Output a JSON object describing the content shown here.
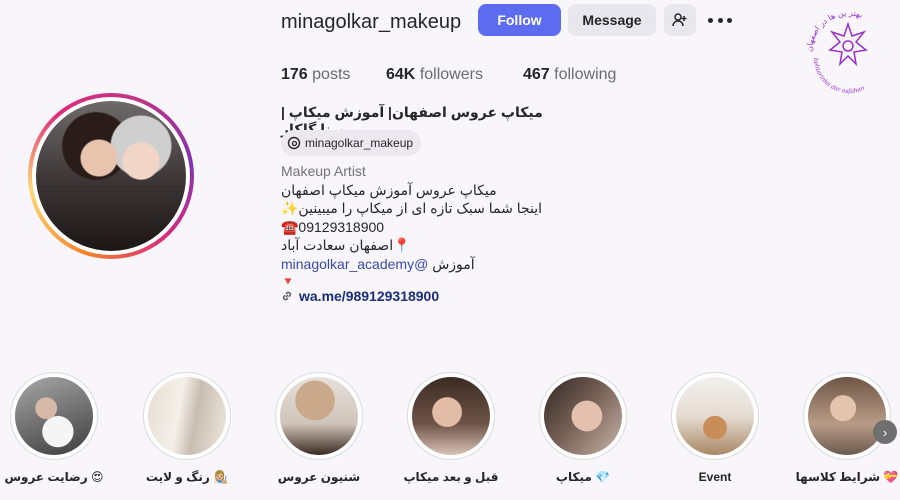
{
  "header": {
    "username": "minagolkar_makeup",
    "follow_label": "Follow",
    "message_label": "Message",
    "add_user_icon": "person-plus-icon",
    "more_icon": "more-options-icon"
  },
  "watermark": {
    "text_top": "بهتر ین ها در اصفهان",
    "text_bottom": "behtarinha dar esfahan",
    "color": "#9b2fc8"
  },
  "stats": {
    "posts": {
      "value": "176",
      "label": "posts"
    },
    "followers": {
      "value": "64K",
      "label": "followers"
    },
    "following": {
      "value": "467",
      "label": "following"
    }
  },
  "bio": {
    "title": "میکاپ عروس اصفهان| آموزش میکاپ | مینا گلکار",
    "threads_handle": "minagolkar_makeup",
    "category": "Makeup Artist",
    "line1": "میکاپ عروس آموزش میکاپ اصفهان",
    "line2": "اینجا شما سبک تازه ای از میکاپ را میبینین✨",
    "line3": "☎️09129318900",
    "line4": "📍اصفهان سعادت آباد",
    "line5_text": "آموزش",
    "line5_mention": "@minagolkar_academy",
    "line6": "🔻",
    "link": "wa.me/989129318900"
  },
  "highlights": [
    {
      "label": "رضایت عروس 😍"
    },
    {
      "label": "رنگ و لایت 👩🏼‍🎨"
    },
    {
      "label": "شنیون عروس"
    },
    {
      "label": "قبل و بعد میکاپ"
    },
    {
      "label": "میکاپ 💎"
    },
    {
      "label": "Event"
    },
    {
      "label": "شرایط کلاسها 💝"
    }
  ],
  "colors": {
    "accent": "#5c6bf0",
    "background": "#f8f5fb"
  }
}
